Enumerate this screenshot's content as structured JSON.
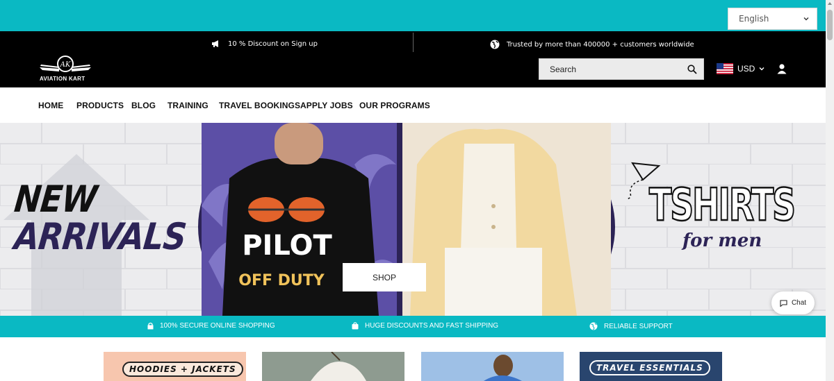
{
  "topbar": {
    "language_selected": "English"
  },
  "header": {
    "promo_left": "10 % Discount on Sign up",
    "promo_right": "Trusted by more than 400000 + customers worldwide",
    "logo_text": "AVIATION KART",
    "search_placeholder": "Search",
    "currency": "USD"
  },
  "nav": {
    "items": [
      {
        "label": "HOME"
      },
      {
        "label": "PRODUCTS"
      },
      {
        "label": "BLOG"
      },
      {
        "label": "TRAINING"
      },
      {
        "label": "TRAVEL BOOKINGS"
      },
      {
        "label": "APPLY JOBS"
      },
      {
        "label": "OUR PROGRAMS"
      }
    ]
  },
  "hero": {
    "heading_line1": "NEW",
    "heading_line2": "ARRIVALS",
    "tshirt_text_line1": "PILOT",
    "tshirt_text_line2": "OFF DUTY",
    "right_heading": "TSHIRTS",
    "right_subheading": "for men",
    "shop_button": "SHOP"
  },
  "features": [
    {
      "icon": "lock-icon",
      "label": "100% SECURE ONLINE SHOPPING"
    },
    {
      "icon": "bag-icon",
      "label": "HUGE DISCOUNTS AND FAST SHIPPING"
    },
    {
      "icon": "globe-icon",
      "label": "RELIABLE SUPPORT"
    }
  ],
  "categories": [
    {
      "label": "HOODIES + JACKETS"
    },
    {
      "label": ""
    },
    {
      "label": ""
    },
    {
      "label": "TRAVEL ESSENTIALS"
    }
  ],
  "chat": {
    "label": "Chat"
  },
  "colors": {
    "accent": "#0ab9c3",
    "header_bg": "#000000",
    "brand_purple": "#2c2356"
  }
}
